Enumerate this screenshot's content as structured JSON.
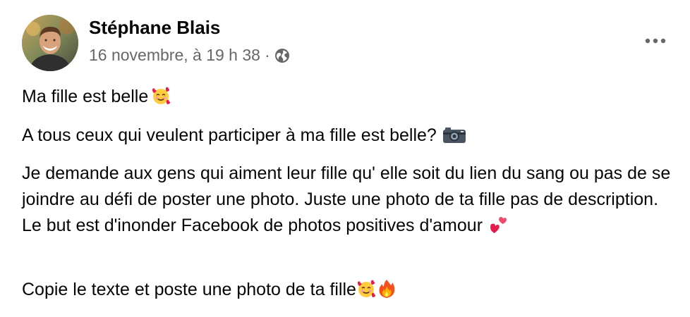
{
  "post": {
    "author_name": "Stéphane Blais",
    "timestamp": "16 novembre, à 19 h 38",
    "separator": "·",
    "privacy_icon": "globe-icon",
    "more_icon": "more-options-icon",
    "paragraphs": {
      "p1": "Ma fille est belle",
      "p2": "A tous ceux qui veulent participer à ma fille est belle?",
      "p3": "Je demande aux gens qui aiment leur fille qu' elle soit du lien du sang ou pas de se joindre au défi de poster une photo. Juste une photo de ta fille pas de description. Le but est d'inonder Facebook de photos positives d'amour",
      "p4": "Copie le texte et poste une photo de ta fille"
    },
    "emojis": {
      "p1": "smiling-face-with-hearts",
      "p2": "camera",
      "p3": "two-hearts",
      "p4": [
        "smiling-face-with-hearts",
        "fire"
      ]
    }
  },
  "colors": {
    "text_primary": "#050505",
    "text_secondary": "#65676b",
    "background": "#ffffff"
  }
}
